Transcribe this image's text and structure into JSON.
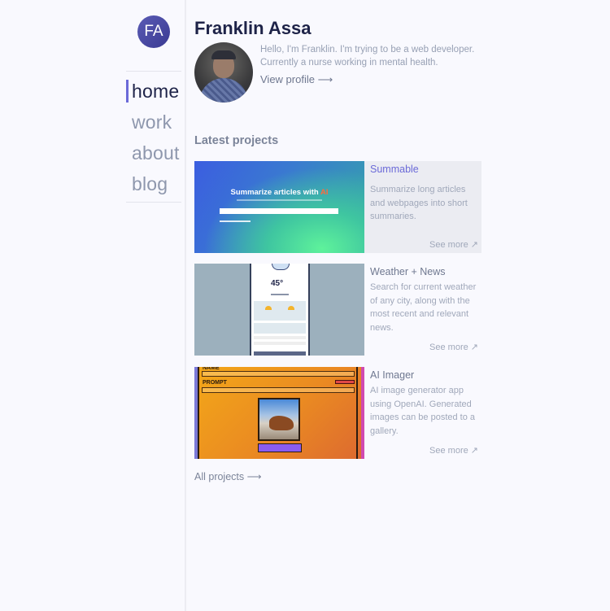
{
  "sidebar": {
    "initials": "FA",
    "nav": [
      {
        "label": "home",
        "active": true
      },
      {
        "label": "work",
        "active": false
      },
      {
        "label": "about",
        "active": false
      },
      {
        "label": "blog",
        "active": false
      }
    ]
  },
  "profile": {
    "name": "Franklin Assa",
    "bio": "Hello, I'm Franklin. I'm trying to be a web developer. Currently a nurse working in mental health.",
    "view_profile": "View profile ⟶"
  },
  "projects_section": {
    "title": "Latest projects",
    "all_projects": "All projects ⟶",
    "items": [
      {
        "title": "Summable",
        "description": "Summarize long articles and webpages into short summaries.",
        "see_more": "See more ↗",
        "thumb_heading": "Summarize articles with ",
        "thumb_heading_accent": "AI"
      },
      {
        "title": "Weather + News",
        "description": "Search for current weather of any city, along with the most recent and relevant news.",
        "see_more": "See more ↗",
        "thumb_temp": "45°"
      },
      {
        "title": "AI Imager",
        "description": "AI image generator app using OpenAI. Generated images can be posted to a gallery.",
        "see_more": "See more ↗",
        "thumb_label_name": "NAME",
        "thumb_label_prompt": "PROMPT"
      }
    ]
  },
  "colors": {
    "accent": "#6b6ad8",
    "background": "#f9f9fe",
    "text_primary": "#1e2348",
    "text_muted": "#a0a8ba"
  }
}
